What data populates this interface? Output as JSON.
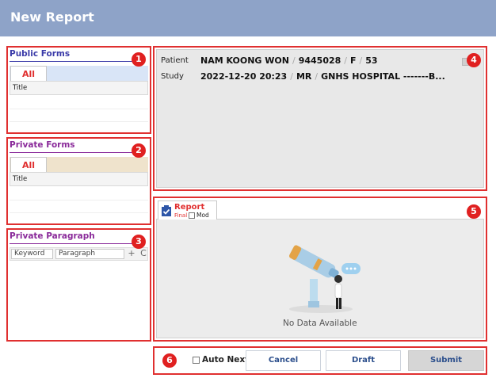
{
  "header": {
    "title": "New Report"
  },
  "public_forms": {
    "title": "Public Forms",
    "tab": "All",
    "column": "Title",
    "badge": "1"
  },
  "private_forms": {
    "title": "Private Forms",
    "tab": "All",
    "column": "Title",
    "badge": "2"
  },
  "private_paragraph": {
    "title": "Private Paragraph",
    "keyword_placeholder": "Keyword",
    "paragraph_placeholder": "Paragraph",
    "add_icon": "+",
    "refresh_icon": "C",
    "badge": "3"
  },
  "patient_info": {
    "patient_label": "Patient",
    "name": "NAM KOONG WON",
    "id": "9445028",
    "sex": "F",
    "age": "53",
    "study_label": "Study",
    "study_date": "2022-12-20 20:23",
    "modality": "MR",
    "hospital": "GNHS HOSPITAL -------B...",
    "badge": "4"
  },
  "report": {
    "tab_label": "Report",
    "status": "Final",
    "mod_label": "Mod",
    "empty_text": "No Data Available",
    "badge": "5"
  },
  "footer": {
    "badge": "6",
    "auto_next_label": "Auto Next",
    "cancel_label": "Cancel",
    "draft_label": "Draft",
    "submit_label": "Submit"
  },
  "colors": {
    "header_bg": "#8ea3c8",
    "highlight_red": "#e03030",
    "public_accent": "#3a3aa8",
    "private_accent": "#8a2a9a"
  }
}
